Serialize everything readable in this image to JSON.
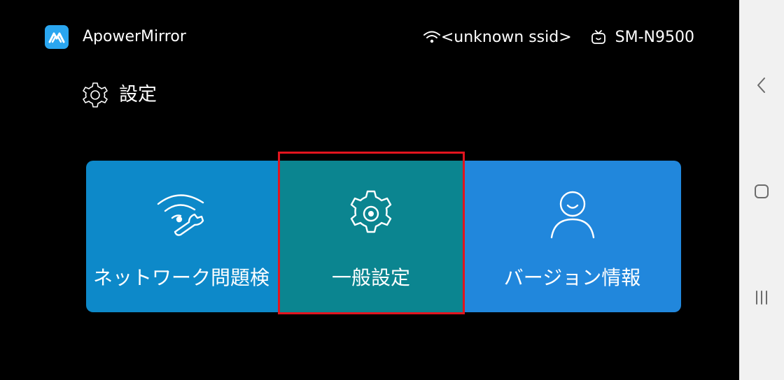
{
  "header": {
    "app_name": "ApowerMirror",
    "ssid": "<unknown ssid>",
    "device_name": "SM-N9500",
    "logo_icon": "apowermirror-logo-icon",
    "wifi_icon": "wifi-icon",
    "tv_icon": "tv-icon"
  },
  "page": {
    "title": "設定",
    "title_icon": "gear-icon"
  },
  "cards": [
    {
      "label": "ネットワーク問題検",
      "icon": "wifi-wrench-icon",
      "color": "#0d89c9"
    },
    {
      "label": "一般設定",
      "icon": "gear-icon",
      "color": "#0b8590",
      "selected": true
    },
    {
      "label": "バージョン情報",
      "icon": "user-icon",
      "color": "#2187dc"
    }
  ],
  "colors": {
    "background": "#000000",
    "selection_border": "#e2141e",
    "nav_bar": "#f1f1f1",
    "logo": "#2aa6f0"
  },
  "nav_bar": {
    "back_icon": "chevron-left-icon",
    "home_icon": "home-square-icon",
    "recent_icon": "recent-apps-icon"
  }
}
